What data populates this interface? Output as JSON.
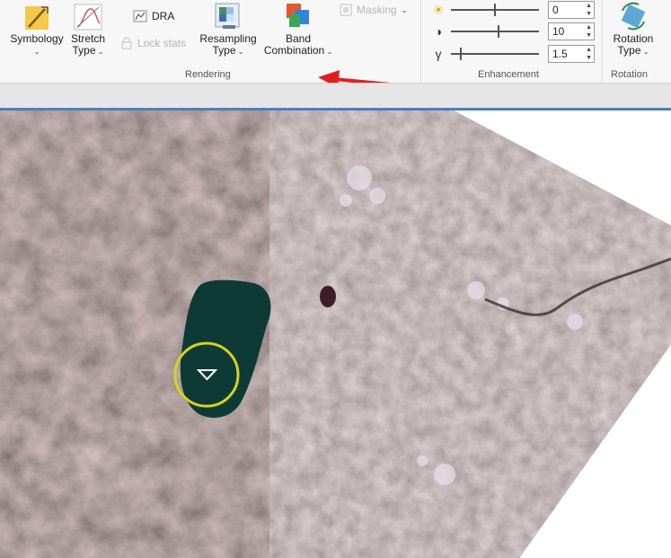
{
  "ribbon": {
    "rendering": {
      "group_label": "Rendering",
      "symbology_label": "Symbology",
      "stretch_label_line1": "Stretch",
      "stretch_label_line2": "Type",
      "dra_label": "DRA",
      "lock_stats_label": "Lock stats",
      "resampling_label_line1": "Resampling",
      "resampling_label_line2": "Type",
      "band_label_line1": "Band",
      "band_label_line2": "Combination"
    },
    "masking_label": "Masking",
    "enhancement": {
      "group_label": "Enhancement",
      "brightness_value": "0",
      "contrast_value": "10",
      "gamma_value": "1.5",
      "gamma_symbol": "γ"
    },
    "rotation": {
      "group_label": "Rotation",
      "button_label_line1": "Rotation",
      "button_label_line2": "Type"
    }
  },
  "annotation": {
    "arrow_color": "#e02020"
  },
  "map": {
    "cursor": "triangle-cursor",
    "highlight_color": "#d8d21c"
  }
}
